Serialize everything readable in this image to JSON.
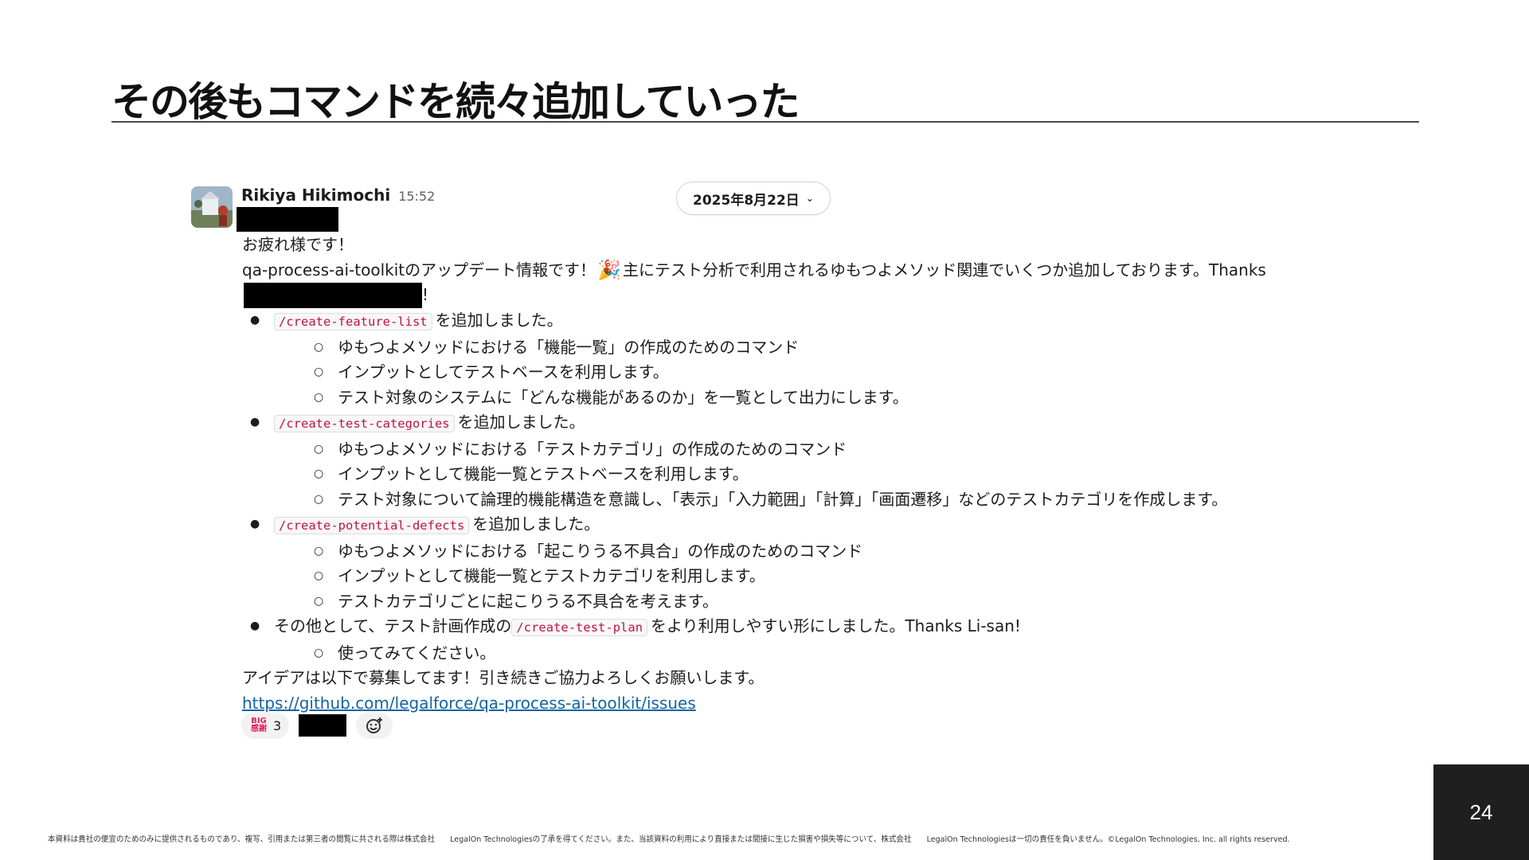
{
  "slide": {
    "title": "その後もコマンドを続々追加していった",
    "page_number": "24",
    "footer_text": "本資料は貴社の便宜のためのみに提供されるものであり、複写、引用または第三者の閲覧に共される際は株式会社　　LegalOn Technologiesの了承を得てください。また、当該資料の利用により直接または間接に生じた損害や損失等について、株式会社　　LegalOn Technologiesは一切の責任を負いません。©LegalOn Technologies, Inc. all rights reserved."
  },
  "message": {
    "author": "Rikiya Hikimochi",
    "time": "15:52",
    "date_pill": "2025年8月22日",
    "greeting": "お疲れ様です！",
    "intro_part1": "qa-process-ai-toolkitのアップデート情報です！",
    "intro_emoji": "🎉",
    "intro_part2": "主にテスト分析で利用されるゆもつよメソッド関連でいくつか追加しております。Thanks",
    "intro_tail": "!",
    "bullets": [
      {
        "code": "/create-feature-list",
        "text": "を追加しました。",
        "subs": [
          "ゆもつよメソッドにおける「機能一覧」の作成のためのコマンド",
          "インプットとしてテストベースを利用します。",
          "テスト対象のシステムに「どんな機能があるのか」を一覧として出力にします。"
        ]
      },
      {
        "code": "/create-test-categories",
        "text": "を追加しました。",
        "subs": [
          "ゆもつよメソッドにおける「テストカテゴリ」の作成のためのコマンド",
          "インプットとして機能一覧とテストベースを利用します。",
          "テスト対象について論理的機能構造を意識し、「表示」「入力範囲」「計算」「画面遷移」などのテストカテゴリを作成します。"
        ]
      },
      {
        "code": "/create-potential-defects",
        "text": "を追加しました。",
        "subs": [
          "ゆもつよメソッドにおける「起こりうる不具合」の作成のためのコマンド",
          "インプットとして機能一覧とテストカテゴリを利用します。",
          "テストカテゴリごとに起こりうる不具合を考えます。"
        ]
      }
    ],
    "last_bullet": {
      "prefix": "その他として、テスト計画作成の",
      "code": "/create-test-plan",
      "suffix": "をより利用しやすい形にしました。Thanks Li-san!",
      "subs": [
        "使ってみてください。"
      ]
    },
    "closing": "アイデアは以下で募集してます！引き続きご協力よろしくお願いします。",
    "link": "https://github.com/legalforce/qa-process-ai-toolkit/issues",
    "reaction": {
      "emoji_line1": "BIG",
      "emoji_line2": "感謝",
      "count": "3"
    }
  }
}
